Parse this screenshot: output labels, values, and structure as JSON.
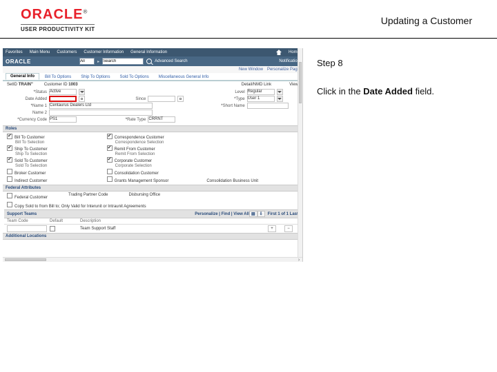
{
  "header": {
    "logo_text": "ORACLE",
    "logo_tm": "®",
    "upk_label": "USER PRODUCTIVITY KIT",
    "title": "Updating a Customer"
  },
  "menubar": {
    "items": [
      "Favorites",
      "Main Menu",
      "Customers",
      "Customer Information",
      "General Information"
    ],
    "home": "Home"
  },
  "searchbar": {
    "logo": "ORACLE",
    "scope": "All",
    "query": "Search",
    "advanced": "Advanced Search",
    "notif": "Notification"
  },
  "personalize": {
    "new_window": "New Window",
    "personalize": "Personalize Page"
  },
  "tabs": {
    "items": [
      {
        "label": "General Info"
      },
      {
        "label": "Bill To Options"
      },
      {
        "label": "Ship To Options"
      },
      {
        "label": "Sold To Options"
      },
      {
        "label": "Miscellaneous General Info"
      }
    ],
    "active": 0
  },
  "id_row": {
    "setid_lbl": "SetID",
    "setid_val": "TRAIN\"",
    "custid_lbl": "Customer ID",
    "custid_val": "1003"
  },
  "detail": {
    "detail_btn": "Detail/NMD Link",
    "view": "View",
    "status_lbl": "Status",
    "status_val": "Active",
    "level_lbl": "Level",
    "level_val": "Regular",
    "date_added_lbl": "Date Added",
    "date_added_val": "",
    "since_lbl": "Since",
    "since_val": "",
    "type_lbl": "Type",
    "type_val": "User 1",
    "name1_lbl": "Name 1",
    "name1_val": "Centaurus Dealers Ltd",
    "short_lbl": "Short Name",
    "short_val": "",
    "name2_lbl": "Name 2",
    "curr_lbl": "Currency Code",
    "curr_val": "PS1",
    "rate_lbl": "Rate Type",
    "rate_val": "CRRNT"
  },
  "roles": {
    "title": "Roles",
    "col1": [
      {
        "label": "Bill To Customer",
        "checked": true
      },
      {
        "label": "Bill To Selection",
        "sub": true
      },
      {
        "label": "Ship To Customer",
        "checked": true
      },
      {
        "label": "Ship To Selection",
        "sub": true
      },
      {
        "label": "Sold To Customer",
        "checked": true
      },
      {
        "label": "Sold To Selection",
        "sub": true
      },
      {
        "label": "Broker Customer",
        "checked": false
      },
      {
        "label": "Indirect Customer",
        "checked": false
      }
    ],
    "col2": [
      {
        "label": "Correspondence Customer",
        "checked": true
      },
      {
        "label": "Correspondence Selection",
        "sub": true
      },
      {
        "label": "Remit From Customer",
        "checked": true
      },
      {
        "label": "Remit From Selection",
        "sub": true
      },
      {
        "label": "Corporate Customer",
        "checked": true
      },
      {
        "label": "Corporate Selection",
        "sub": true
      },
      {
        "label": "Consolidation Customer",
        "checked": false
      },
      {
        "label": "Grants Management Sponsor",
        "checked": false
      }
    ],
    "col3_label": "Consolidation Business Unit"
  },
  "federal": {
    "title": "Federal Attributes",
    "cust_lbl": "Federal Customer",
    "trading_lbl": "Trading Partner Code",
    "disbursing_lbl": "Disbursing Office",
    "copy_lbl": "Copy Sold to from Bill to; Only Valid for Interunit or Intraunit Agreements"
  },
  "support": {
    "title": "Support Teams",
    "personalize": "Personalize",
    "find": "Find",
    "view_all": "View All",
    "range": "First  1 of 1  Last",
    "hdr_team": "Team Code",
    "hdr_default": "Default",
    "hdr_desc": "Description",
    "row_desc": "Team Support Staff"
  },
  "addl": {
    "title": "Additional Locations"
  },
  "panel": {
    "step": "Step 8",
    "instr_pre": "Click in the ",
    "instr_bold": "Date Added",
    "instr_post": " field."
  }
}
